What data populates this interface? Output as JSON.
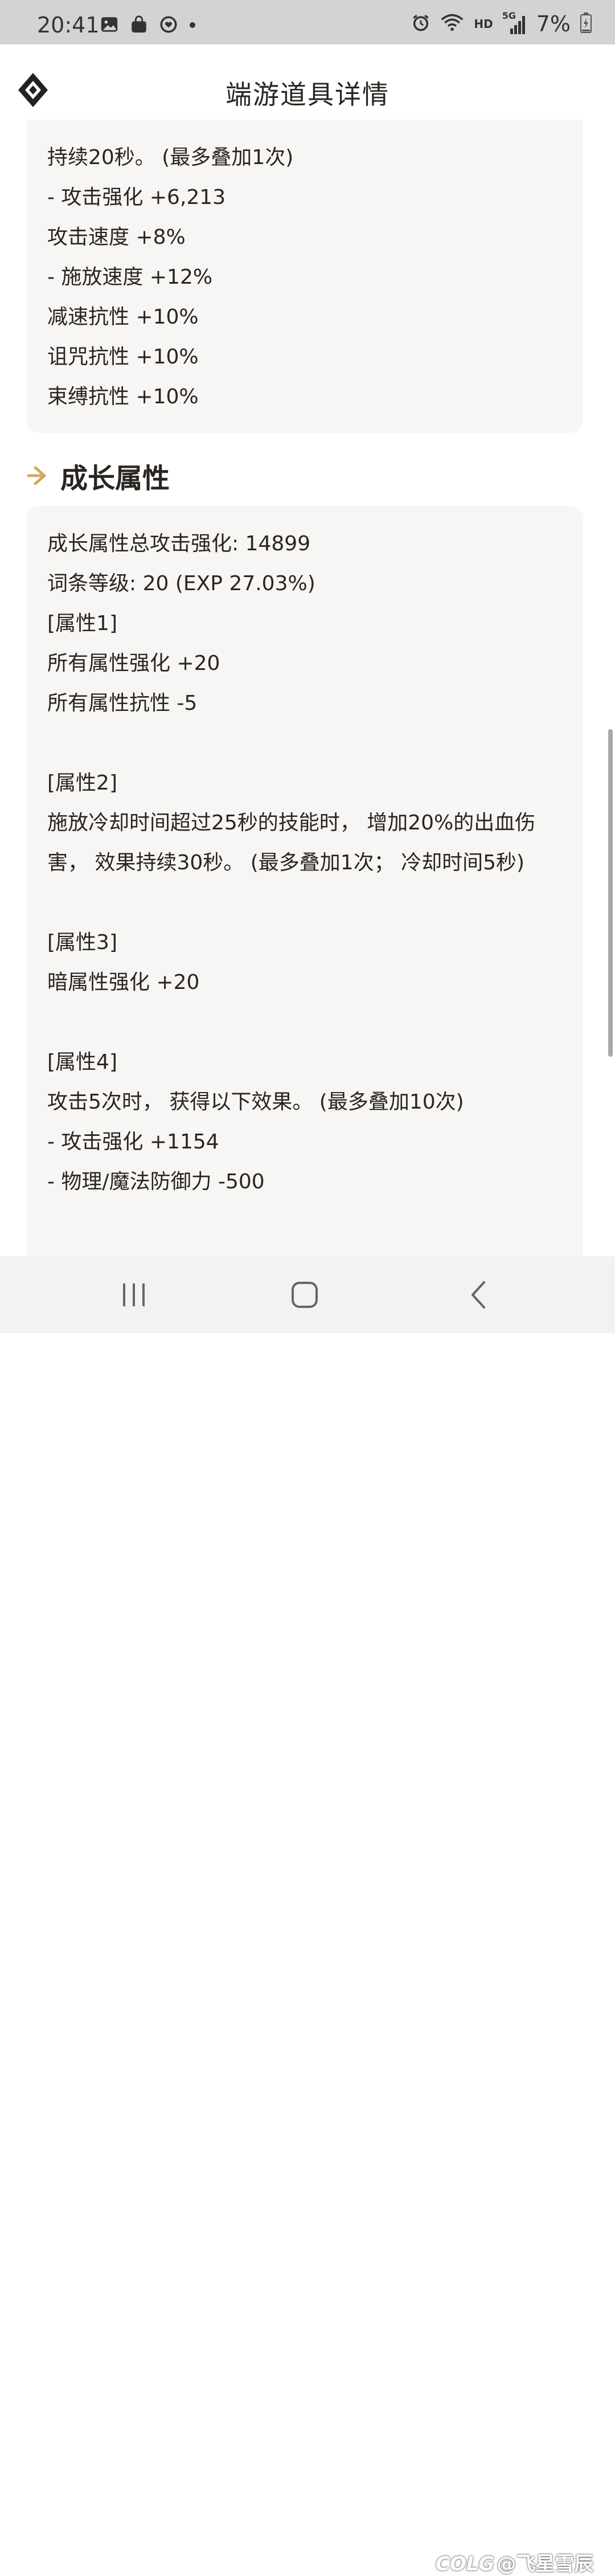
{
  "status_bar": {
    "time": "20:41",
    "hd_label": "HD",
    "network_label": "5G",
    "battery_percent": "7%",
    "icons": [
      "image-icon",
      "shopping-bag-icon",
      "heart-face-icon",
      "dot-icon",
      "alarm-icon",
      "wifi-icon",
      "signal-icon",
      "battery-charging-icon"
    ]
  },
  "header": {
    "title": "端游道具详情",
    "logo_icon": "diamond-logo-icon"
  },
  "card_top": {
    "lines": [
      "持续20秒。 (最多叠加1次)",
      "- 攻击强化 +6,213",
      "攻击速度 +8%",
      "- 施放速度 +12%",
      "减速抗性 +10%",
      "诅咒抗性 +10%",
      "束缚抗性 +10%"
    ]
  },
  "growth_section": {
    "title": "成长属性",
    "arrow_icon": "arrow-right-icon",
    "accent_color": "#d4a862"
  },
  "card_growth": {
    "lines": [
      "成长属性总攻击强化: 14899",
      "词条等级: 20 (EXP 27.03%)",
      "[属性1]",
      "所有属性强化 +20",
      "所有属性抗性 -5",
      "[属性2]",
      "施放冷却时间超过25秒的技能时， 增加20%的出血伤",
      "害， 效果持续30秒。 (最多叠加1次； 冷却时间5秒)",
      "[属性3]",
      "暗属性强化 +20",
      "[属性4]",
      "攻击5次时， 获得以下效果。 (最多叠加10次)",
      "- 攻击强化 +1154",
      "- 物理/魔法防御力 -500"
    ]
  },
  "nav_bar": {
    "buttons": [
      "recent-apps-icon",
      "home-icon",
      "back-icon"
    ]
  },
  "watermark": "@飞星雪辰",
  "watermark_logo": "COLG"
}
